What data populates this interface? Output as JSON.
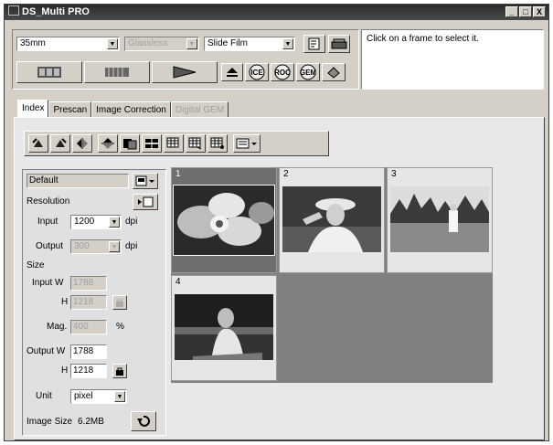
{
  "window": {
    "title": "DS_Multi PRO",
    "minimize": "_",
    "maximize": "□",
    "close": "X"
  },
  "toolbar": {
    "film_size": "35mm",
    "holder": "Glassless",
    "film_type": "Slide Film",
    "icons": {
      "ice_label": "ICE",
      "roc_label": "ROC",
      "gem_label": "GEM"
    }
  },
  "message": "Click on a frame to select it.",
  "tabs": [
    {
      "label": "Index",
      "active": true
    },
    {
      "label": "Prescan",
      "active": false
    },
    {
      "label": "Image Correction",
      "active": false
    },
    {
      "label": "Digital GEM",
      "active": false,
      "disabled": true
    }
  ],
  "settings": {
    "preset": "Default",
    "resolution_label": "Resolution",
    "input_label": "Input",
    "input_value": "1200",
    "input_unit": "dpi",
    "output_label": "Output",
    "output_value": "300",
    "output_unit": "dpi",
    "size_label": "Size",
    "input_w_label": "Input W",
    "input_w_value": "1788",
    "input_h_label": "H",
    "input_h_value": "1218",
    "mag_label": "Mag.",
    "mag_value": "400",
    "mag_unit": "%",
    "output_w_label": "Output W",
    "output_w_value": "1788",
    "output_h_label": "H",
    "output_h_value": "1218",
    "unit_label": "Unit",
    "unit_value": "pixel",
    "image_size_label": "Image Size",
    "image_size_value": "6.2MB"
  },
  "frames": [
    {
      "number": "1",
      "subject": "orchid",
      "selected": true
    },
    {
      "number": "2",
      "subject": "woman-hat",
      "selected": false
    },
    {
      "number": "3",
      "subject": "lake-figure",
      "selected": false
    },
    {
      "number": "4",
      "subject": "woman-sitting",
      "selected": false
    }
  ],
  "colors": {
    "window_bg": "#d4d0c8",
    "titlebar": "#3a3a3a",
    "grid_bg": "#808080"
  }
}
